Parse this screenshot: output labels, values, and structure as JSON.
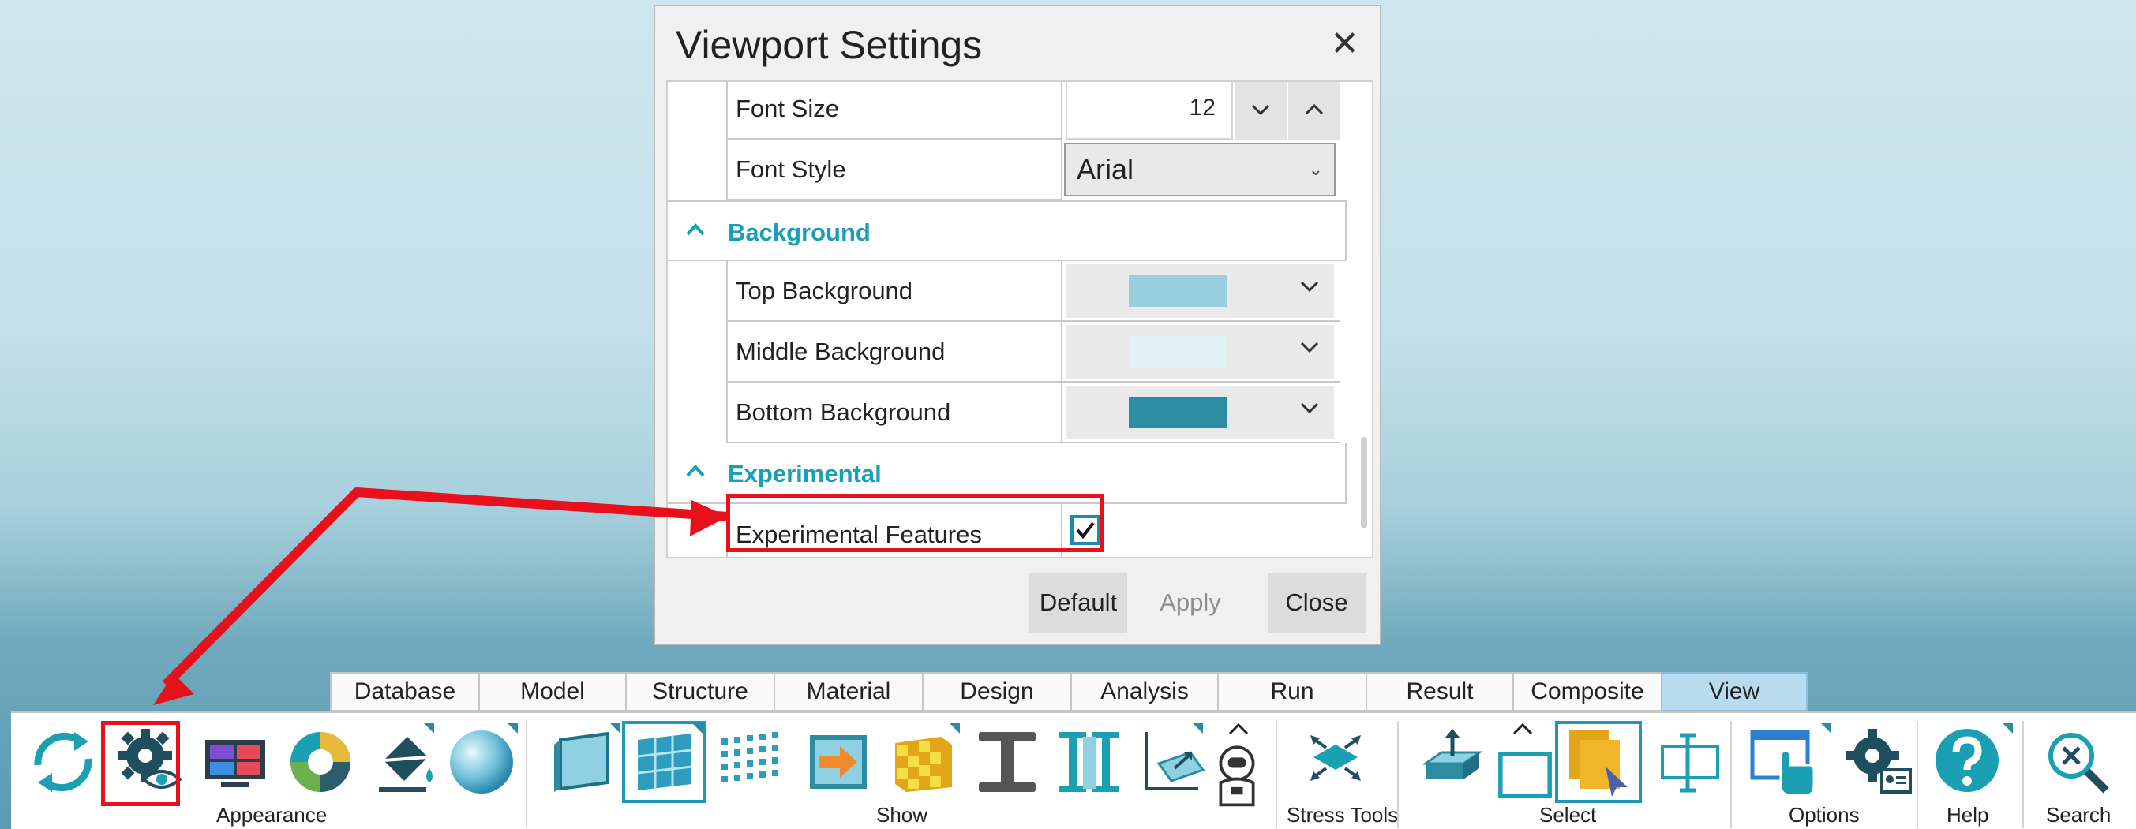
{
  "dialog": {
    "title": "Viewport Settings",
    "close_icon": "close-icon",
    "rows": {
      "font_size": {
        "label": "Font Size",
        "value": "12"
      },
      "font_style": {
        "label": "Font Style",
        "value": "Arial"
      },
      "top_background": {
        "label": "Top Background",
        "color": "#97cee0"
      },
      "middle_background": {
        "label": "Middle Background",
        "color": "#e1f1f6"
      },
      "bottom_background": {
        "label": "Bottom Background",
        "color": "#2d8ba2"
      },
      "experimental_features": {
        "label": "Experimental Features",
        "checked": true
      }
    },
    "sections": {
      "background": "Background",
      "experimental": "Experimental"
    },
    "buttons": {
      "default": "Default",
      "apply": "Apply",
      "close": "Close"
    }
  },
  "ribbon": {
    "tabs": [
      "Database",
      "Model",
      "Structure",
      "Material",
      "Design",
      "Analysis",
      "Run",
      "Result",
      "Composite",
      "View"
    ],
    "active_tab": "View",
    "groups": {
      "appearance": "Appearance",
      "show": "Show",
      "stress_tools": "Stress Tools",
      "select": "Select",
      "options": "Options",
      "help": "Help",
      "search": "Search"
    }
  },
  "colors": {
    "accent": "#1b9fb3",
    "annotation_red": "#e8101a",
    "active_tab": "#b8dbee"
  }
}
